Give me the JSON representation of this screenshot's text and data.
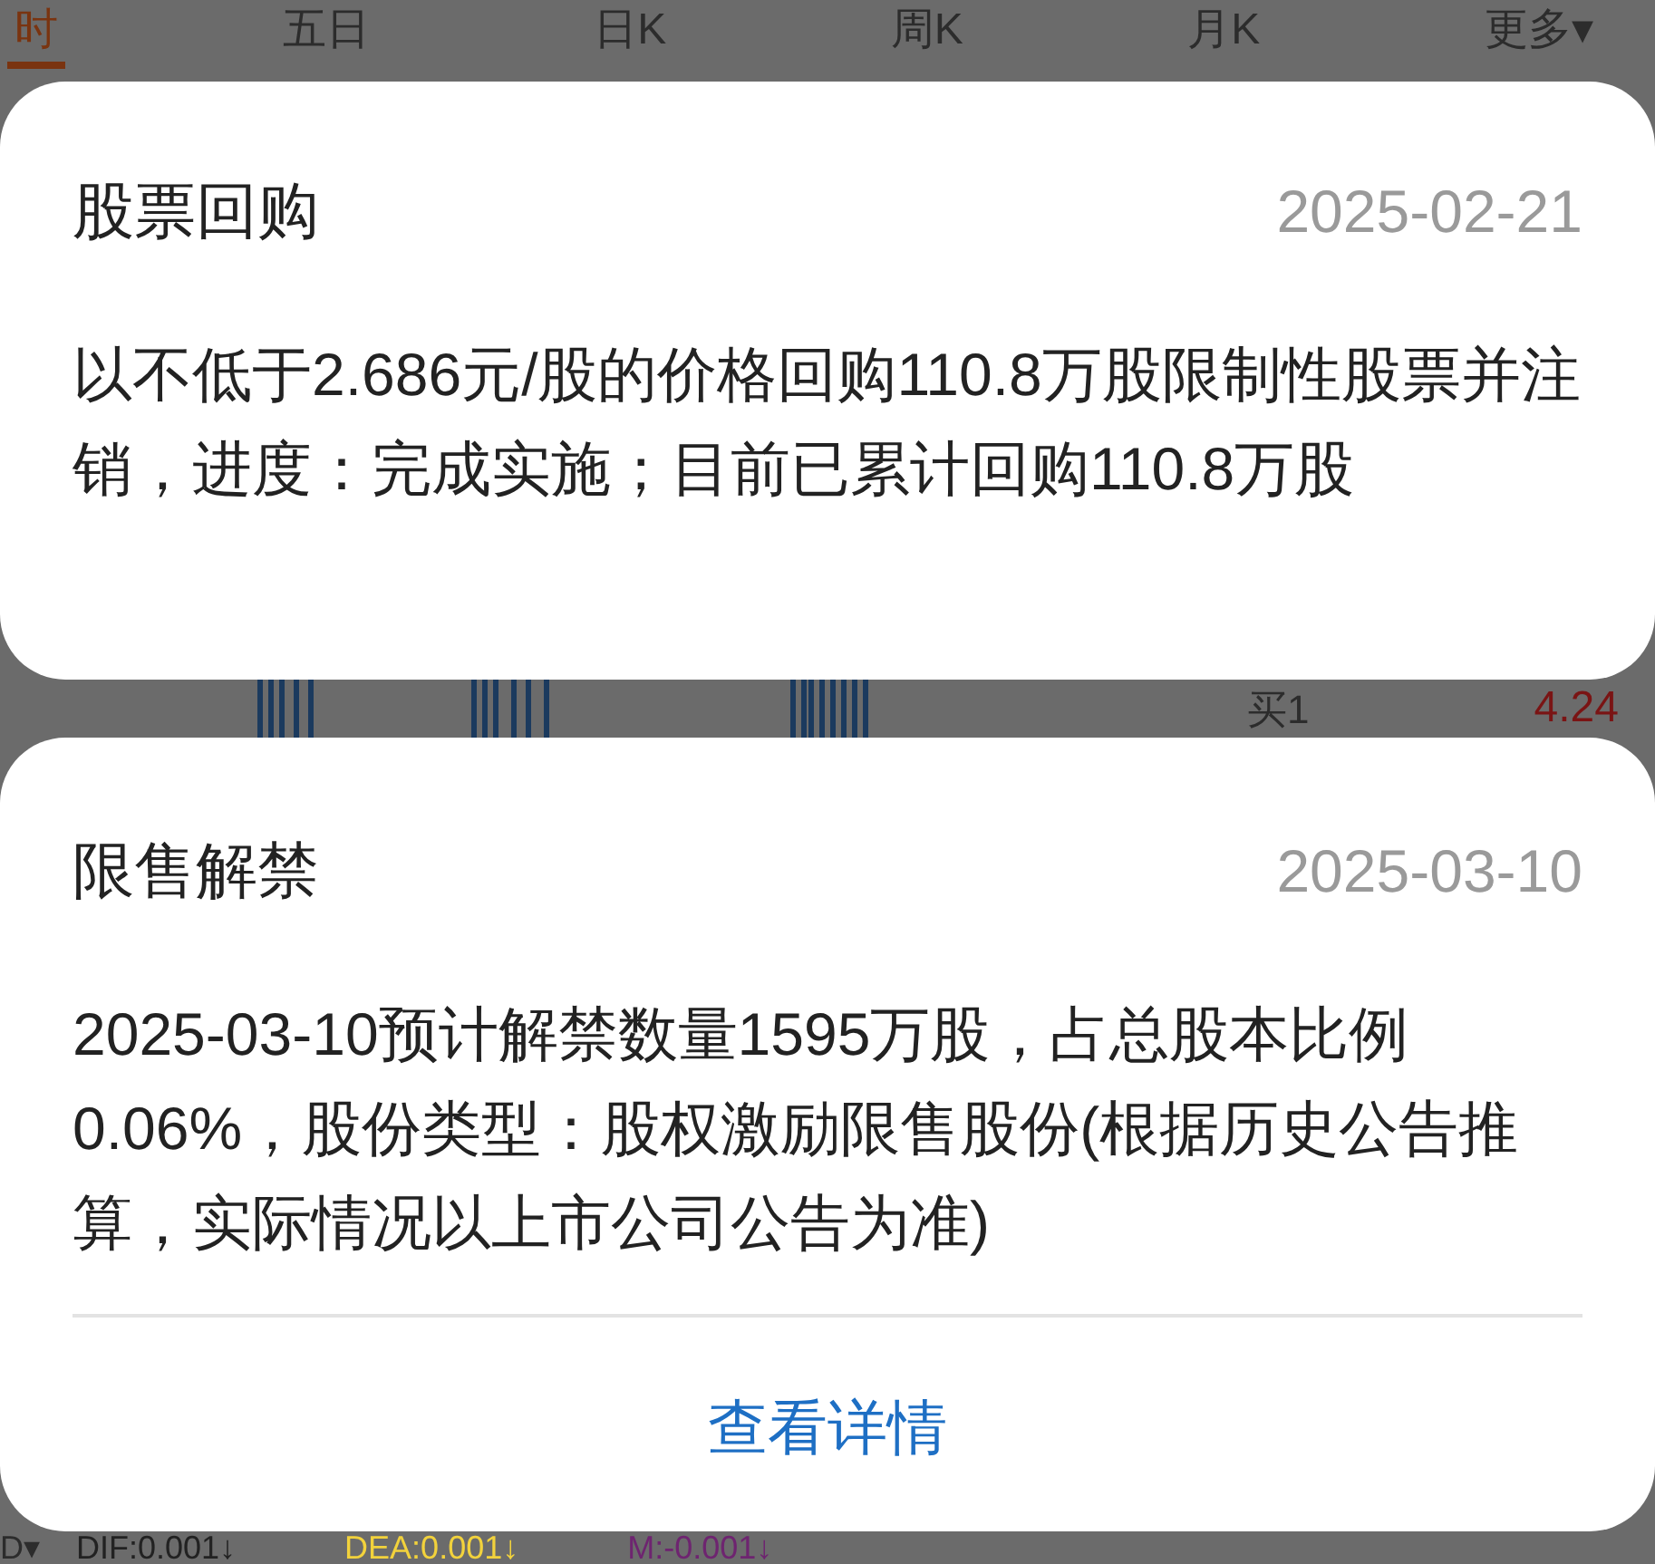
{
  "background_tabs": [
    {
      "label": "时",
      "selected": true
    },
    {
      "label": "五日",
      "selected": false
    },
    {
      "label": "日K",
      "selected": false
    },
    {
      "label": "周K",
      "selected": false
    },
    {
      "label": "月K",
      "selected": false
    },
    {
      "label": "更多▾",
      "selected": false
    }
  ],
  "order_book_row": {
    "label": "买1",
    "price": "4.24"
  },
  "indicator_bar": {
    "selector": "D▾",
    "values": [
      {
        "label": "DIF:0.001↓",
        "color": "#222222"
      },
      {
        "label": "DEA:0.001↓",
        "color": "#f2d23c"
      },
      {
        "label": "M:-0.001↓",
        "color": "#6e2470"
      }
    ]
  },
  "cards": [
    {
      "title": "股票回购",
      "date": "2025-02-21",
      "body": "以不低于2.686元/股的价格回购110.8万股限制性股票并注销，进度：完成实施；目前已累计回购110.8万股"
    },
    {
      "title": "限售解禁",
      "date": "2025-03-10",
      "body": "2025-03-10预计解禁数量1595万股，占总股本比例0.06%，股份类型：股权激励限售股份(根据历史公告推算，实际情况以上市公司公告为准)",
      "link": "查看详情"
    }
  ]
}
